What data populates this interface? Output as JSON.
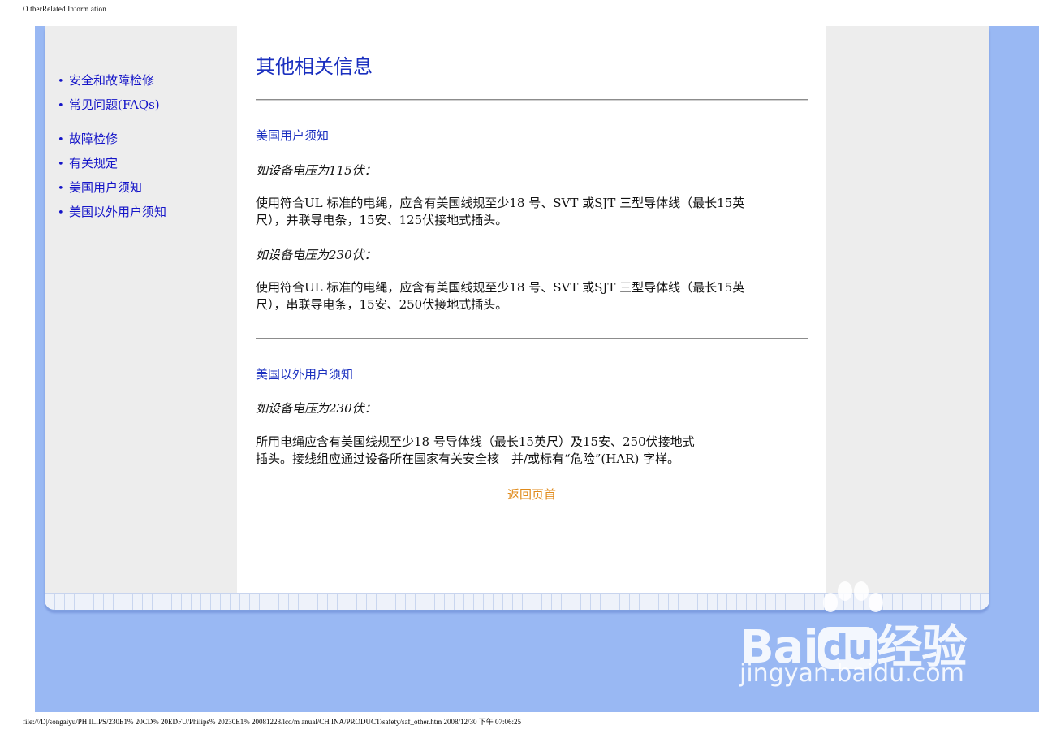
{
  "header": {
    "doc_title": "O therRelated Inform ation"
  },
  "sidebar": {
    "items": [
      {
        "label": "安全和故障检修"
      },
      {
        "label": "常见问题(FAQs)"
      },
      {
        "label": "故障检修"
      },
      {
        "label": "有关规定"
      },
      {
        "label": "美国用户须知"
      },
      {
        "label": "美国以外用户须知"
      }
    ]
  },
  "main": {
    "title": "其他相关信息",
    "us": {
      "heading": "美国用户须知",
      "cond1": "如设备电压为115伏：",
      "para1_l1": "使用符合UL 标准的电绳，应含有美国线规至少18 号、SVT 或SJT 三型导体线（最长15英",
      "para1_l2": "尺），并联导电条，15安、125伏接地式插头。",
      "cond2": "如设备电压为230伏：",
      "para2_l1": "使用符合UL 标准的电绳，应含有美国线规至少18 号、SVT 或SJT 三型导体线（最长15英",
      "para2_l2": "尺），串联导电条，15安、250伏接地式插头。"
    },
    "intl": {
      "heading": "美国以外用户须知",
      "cond": "如设备电压为230伏：",
      "para_l1": "所用电绳应含有美国线规至少18 号导体线（最长15英尺）及15安、250伏接地式",
      "para_l2": "插头。接线组应通过设备所在国家有关安全核　并/或标有“危险”(HAR) 字样。"
    },
    "back_to_top": "返回页首"
  },
  "watermark": {
    "brand_a": "Bai",
    "brand_b": "du",
    "brand_c": "经验",
    "sub": "jingyan.baidu.com"
  },
  "footer": {
    "path": "file:///D|/songaiyu/PH ILIPS/230E1% 20CD% 20EDFU/Philips% 20230E1% 20081228/lcd/m anual/CH INA/PRODUCT/safety/saf_other.htm 2008/12/30 下午 07:06:25"
  },
  "colors": {
    "link": "#1515c8",
    "heading": "#1a2fbf",
    "accent_orange": "#e08a1a",
    "page_bg": "#99b8f3"
  }
}
